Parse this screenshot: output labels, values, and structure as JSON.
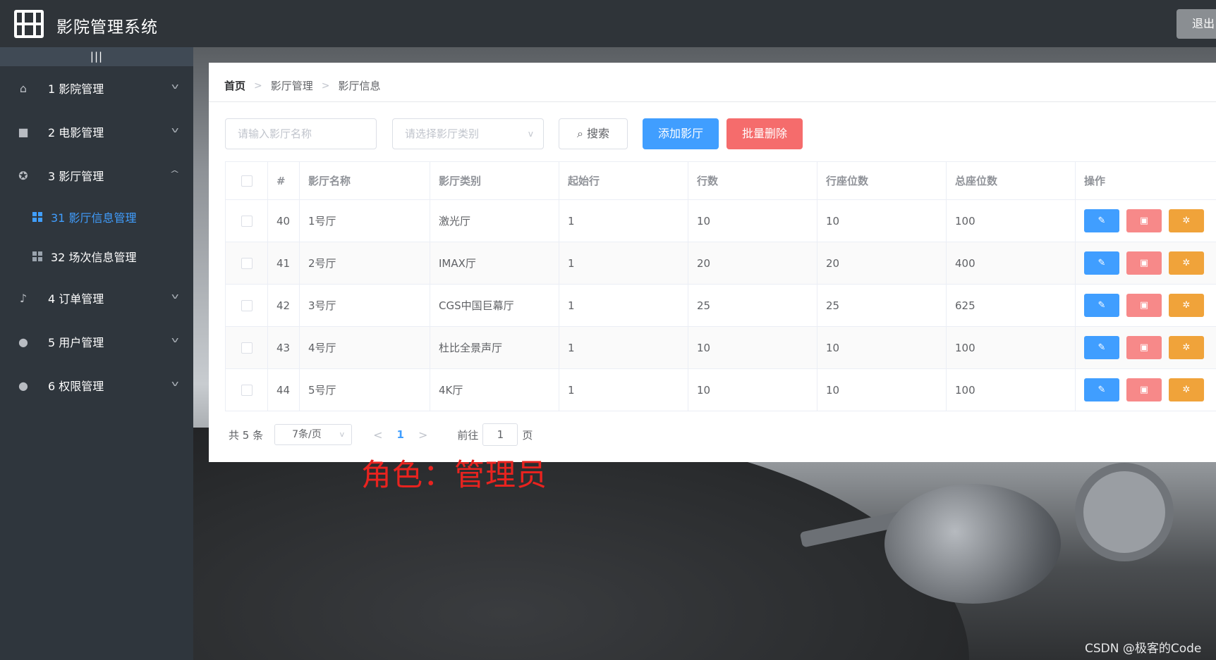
{
  "header": {
    "title": "影院管理系统",
    "logout_label": "退出"
  },
  "sidebar": {
    "collapse_glyph": "|||",
    "items": [
      {
        "label": "1 影院管理",
        "icon": "home-icon",
        "expanded": false
      },
      {
        "label": "2 电影管理",
        "icon": "camera-icon",
        "expanded": false
      },
      {
        "label": "3 影厅管理",
        "icon": "film-reel-icon",
        "expanded": true,
        "children": [
          {
            "label": "31 影厅信息管理",
            "active": true
          },
          {
            "label": "32 场次信息管理",
            "active": false
          }
        ]
      },
      {
        "label": "4 订单管理",
        "icon": "bell-icon",
        "expanded": false
      },
      {
        "label": "5 用户管理",
        "icon": "user-icon",
        "expanded": false
      },
      {
        "label": "6 权限管理",
        "icon": "user-icon",
        "expanded": false
      }
    ]
  },
  "breadcrumb": [
    "首页",
    "影厅管理",
    "影厅信息"
  ],
  "toolbar": {
    "name_placeholder": "请输入影厅名称",
    "type_placeholder": "请选择影厅类别",
    "search_label": "搜索",
    "add_label": "添加影厅",
    "batch_delete_label": "批量删除"
  },
  "table": {
    "columns": [
      "#",
      "影厅名称",
      "影厅类别",
      "起始行",
      "行数",
      "行座位数",
      "总座位数",
      "操作"
    ],
    "rows": [
      {
        "id": "40",
        "name": "1号厅",
        "type": "激光厅",
        "start_row": "1",
        "rows": "10",
        "seats_per_row": "10",
        "total_seats": "100"
      },
      {
        "id": "41",
        "name": "2号厅",
        "type": "IMAX厅",
        "start_row": "1",
        "rows": "20",
        "seats_per_row": "20",
        "total_seats": "400"
      },
      {
        "id": "42",
        "name": "3号厅",
        "type": "CGS中国巨幕厅",
        "start_row": "1",
        "rows": "25",
        "seats_per_row": "25",
        "total_seats": "625"
      },
      {
        "id": "43",
        "name": "4号厅",
        "type": "杜比全景声厅",
        "start_row": "1",
        "rows": "10",
        "seats_per_row": "10",
        "total_seats": "100"
      },
      {
        "id": "44",
        "name": "5号厅",
        "type": "4K厅",
        "start_row": "1",
        "rows": "10",
        "seats_per_row": "10",
        "total_seats": "100"
      }
    ]
  },
  "pagination": {
    "total_text": "共 5 条",
    "page_size": "7条/页",
    "current_page": "1",
    "goto_prefix": "前往",
    "goto_value": "1",
    "goto_suffix": "页"
  },
  "annotation": "角色：管理员",
  "watermark": "CSDN @极客的Code",
  "colors": {
    "primary": "#409eff",
    "danger": "#f56c6c",
    "warning": "#f0a33a",
    "annotation": "#e8231f"
  }
}
